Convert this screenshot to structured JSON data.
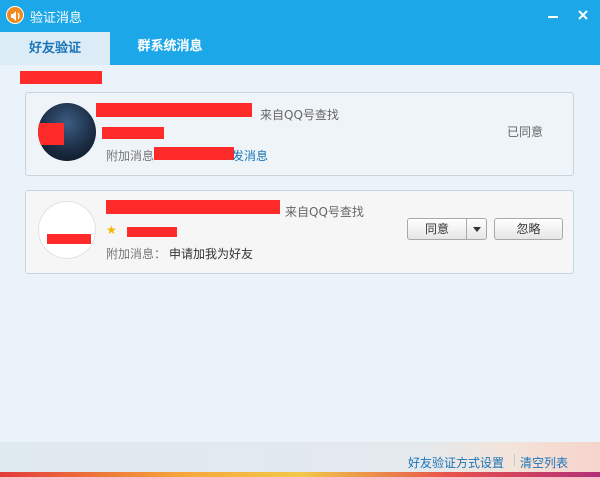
{
  "window": {
    "title": "验证消息",
    "app_icon": "qq-speaker-icon"
  },
  "tabs": [
    {
      "label": "好友验证",
      "active": true
    },
    {
      "label": "群系统消息",
      "active": false
    }
  ],
  "requests": [
    {
      "source": "来自QQ号查找",
      "extra_label": "附加消息",
      "extra_value_visible": "发消息",
      "status": "已同意"
    },
    {
      "source": "来自QQ号查找",
      "extra_label": "附加消息：",
      "extra_value": "申请加我为好友",
      "actions": {
        "agree": "同意",
        "ignore": "忽略"
      }
    }
  ],
  "footer": {
    "settings_link": "好友验证方式设置",
    "clear_link": "清空列表"
  },
  "colors": {
    "titlebar": "#1ba7e8",
    "link": "#1a74b9",
    "redaction": "#ff2a2a"
  }
}
